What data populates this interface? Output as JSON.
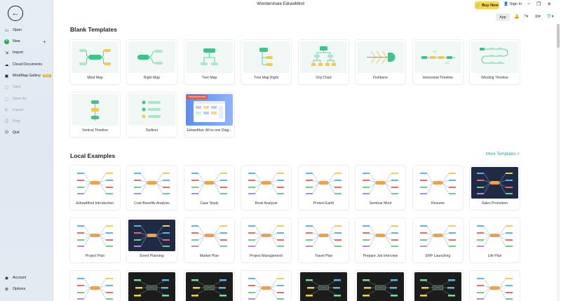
{
  "titlebar": {
    "title": "Wondershare EdrawMind",
    "buy_label": "Buy Now",
    "signin_label": "Sign In",
    "app_label": "App"
  },
  "sidebar": {
    "items": [
      {
        "label": "Open",
        "icon": "folder-icon",
        "state": "enabled"
      },
      {
        "label": "New",
        "icon": "new-icon",
        "state": "enabled"
      },
      {
        "label": "Import",
        "icon": "import-icon",
        "state": "enabled"
      },
      {
        "label": "Cloud Documents",
        "icon": "cloud-icon",
        "state": "enabled"
      },
      {
        "label": "MindMap Gallery",
        "icon": "gallery-icon",
        "state": "enabled",
        "badge": "Beta"
      },
      {
        "label": "Save",
        "icon": "save-icon",
        "state": "disabled"
      },
      {
        "label": "Save As",
        "icon": "save-as-icon",
        "state": "disabled"
      },
      {
        "label": "Export",
        "icon": "export-icon",
        "state": "disabled"
      },
      {
        "label": "Print",
        "icon": "print-icon",
        "state": "disabled"
      },
      {
        "label": "Quit",
        "icon": "quit-icon",
        "state": "enabled"
      }
    ],
    "bottom": [
      {
        "label": "Account",
        "icon": "account-icon"
      },
      {
        "label": "Options",
        "icon": "gear-icon"
      }
    ]
  },
  "blank": {
    "title": "Blank Templates",
    "templates": [
      {
        "label": "Mind Map"
      },
      {
        "label": "Right Map"
      },
      {
        "label": "Tree Map"
      },
      {
        "label": "Tree Map Right"
      },
      {
        "label": "Org Chart"
      },
      {
        "label": "Fishbone"
      },
      {
        "label": "Horizontal Timeline"
      },
      {
        "label": "Winding Timeline"
      },
      {
        "label": "Vertical Timeline"
      },
      {
        "label": "Outliner"
      },
      {
        "label": "EdrawMax: All-in-one Diag...",
        "badge": "Recommended"
      }
    ]
  },
  "examples": {
    "title": "Local Examples",
    "more_label": "More Templates >",
    "items": [
      {
        "label": "EdrawMind Introduction"
      },
      {
        "label": "Cost-Benefits Analysis"
      },
      {
        "label": "Case Study"
      },
      {
        "label": "Book Analysis"
      },
      {
        "label": "Protect Earth"
      },
      {
        "label": "Seminar Mind"
      },
      {
        "label": "Resume"
      },
      {
        "label": "Sales Promotion"
      },
      {
        "label": "Project Plan"
      },
      {
        "label": "Event Planning"
      },
      {
        "label": "Market Plan"
      },
      {
        "label": "Project Management"
      },
      {
        "label": "Travel Plan"
      },
      {
        "label": "Prepare Job Interview"
      },
      {
        "label": "ERP Launching"
      },
      {
        "label": "Life Plan"
      }
    ]
  },
  "colors": {
    "accent": "#2aa198",
    "template_green": "#3ac68a",
    "template_yellow": "#f7c948",
    "template_bg": "#f0f7f4",
    "buy_yellow": "#f9d74c"
  }
}
